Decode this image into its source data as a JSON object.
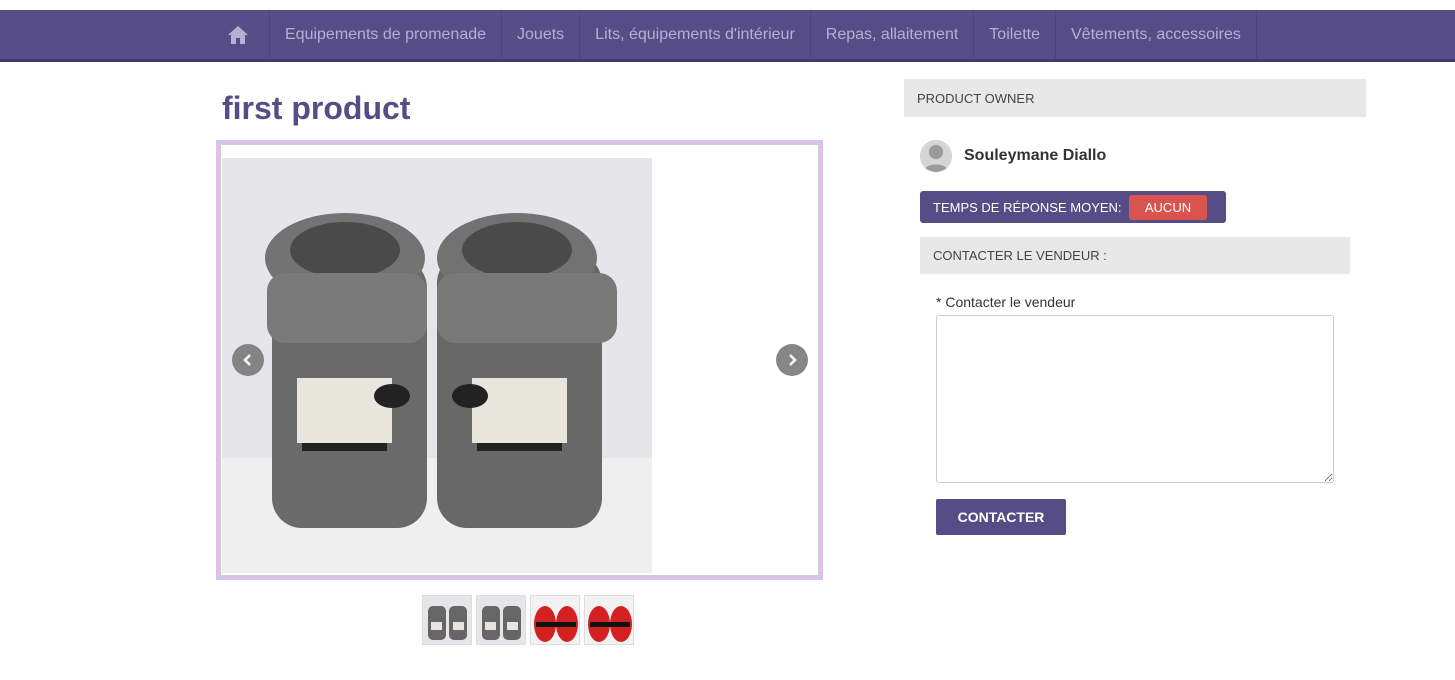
{
  "nav": {
    "home_icon": "home-icon",
    "items": [
      {
        "label": "Equipements de promenade"
      },
      {
        "label": "Jouets"
      },
      {
        "label": "Lits, équipements d'intérieur"
      },
      {
        "label": "Repas, allaitement"
      },
      {
        "label": "Toilette"
      },
      {
        "label": "Vêtements, accessoires"
      }
    ]
  },
  "product": {
    "title": "first product",
    "thumbnails": [
      {
        "color": "grey"
      },
      {
        "color": "grey"
      },
      {
        "color": "red"
      },
      {
        "color": "red"
      }
    ]
  },
  "owner": {
    "header": "PRODUCT OWNER",
    "name": "Souleymane Diallo",
    "response_label": "TEMPS DE RÉPONSE MOYEN:",
    "response_value": "AUCUN"
  },
  "contact": {
    "header": "CONTACTER LE VENDEUR :",
    "field_label": "* Contacter le vendeur",
    "message_value": "",
    "button_label": "CONTACTER"
  },
  "colors": {
    "brand": "#564d87",
    "badge": "#d9534f",
    "carousel_border": "#d9c4e6"
  }
}
